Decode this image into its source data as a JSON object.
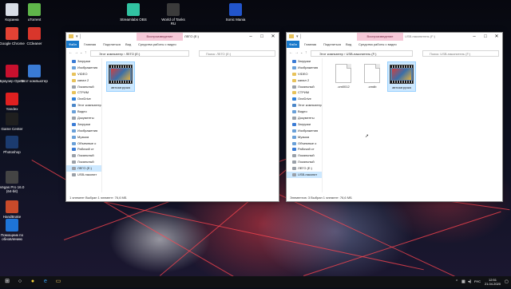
{
  "desktop": {
    "icons": [
      {
        "label": "Корзина",
        "color": "#d8dde6"
      },
      {
        "label": "uTorrent",
        "color": "#5fb64a"
      },
      {
        "label": "Google Chrome",
        "color": "#e34234"
      },
      {
        "label": "CCleaner",
        "color": "#d9362b"
      },
      {
        "label": "Браузер Opera",
        "color": "#c8102e"
      },
      {
        "label": "Этот компьютер",
        "color": "#3a7bd5"
      },
      {
        "label": "Yandex",
        "color": "#e02020"
      },
      {
        "label": "Game Center",
        "color": "#1f1f1f"
      },
      {
        "label": "Photoshop",
        "color": "#1b3b6f"
      },
      {
        "label": "Vegas Pro 16.0 (64-bit)",
        "color": "#444444"
      },
      {
        "label": "HandBrake",
        "color": "#c94a2a"
      },
      {
        "label": "Помощник по обновлению",
        "color": "#1e74d8"
      },
      {
        "label": "Streamlabs OBS",
        "color": "#31c3a2"
      },
      {
        "label": "World of Tanks RU",
        "color": "#3b3b3b"
      },
      {
        "label": "Sonic Mania",
        "color": "#2255cc"
      }
    ]
  },
  "left_window": {
    "title": "ЛЕГО (E:)",
    "context_group": "Воспроизведение",
    "tabs": [
      "Файл",
      "Главная",
      "Поделиться",
      "Вид",
      "Средства работы с видео"
    ],
    "address": "Этот компьютер › ЛЕГО (E:)",
    "search_placeholder": "Поиск: ЛЕГО (E:)",
    "nav_items": [
      "Загрузки",
      "Изображения",
      "VIDEO",
      "канал 2",
      "Локальный",
      "СТРИМ",
      "OneDrive",
      "Этот компьютер",
      "Видео",
      "Документы",
      "Загрузки",
      "Изображения",
      "Музыка",
      "Объемные о",
      "Рабочий ст",
      "Локальный",
      "Локальный",
      "ЛЕГО (E:)",
      "USB-накопит"
    ],
    "files": [
      {
        "name": "автозагрузка",
        "kind": "video"
      }
    ],
    "status": "1 элемент   Выбран 1 элемент: 76,6 МБ"
  },
  "right_window": {
    "title": "USB-накопитель (F:)",
    "context_group": "Воспроизведение",
    "tabs": [
      "Файл",
      "Главная",
      "Поделиться",
      "Вид",
      "Средства работы с видео"
    ],
    "address": "Этот компьютер › USB-накопитель (F:)",
    "search_placeholder": "Поиск: USB-накопитель (F:)",
    "nav_items": [
      "Загрузки",
      "Изображения",
      "VIDEO",
      "канал 2",
      "Локальный",
      "СТРИМ",
      "OneDrive",
      "Этот компьютер",
      "Видео",
      "Документы",
      "Загрузки",
      "Изображения",
      "Музыка",
      "Объемные о",
      "Рабочий ст",
      "Локальный",
      "Локальный",
      "ЛЕГО (E:)",
      "USB-накопит"
    ],
    "files": [
      {
        "name": ".cm0012",
        "kind": "blank"
      },
      {
        "name": ".cmdb",
        "kind": "blank"
      },
      {
        "name": "автозагрузка",
        "kind": "video"
      }
    ],
    "status": "Элементов: 3   Выбран 1 элемент: 76,6 МБ"
  },
  "taskbar": {
    "icons": [
      "windows-icon",
      "search-icon",
      "yandex-browser-icon",
      "edge-icon",
      "explorer-icon"
    ],
    "language": "РУС",
    "time": "12:51",
    "date": "21.04.2020"
  }
}
